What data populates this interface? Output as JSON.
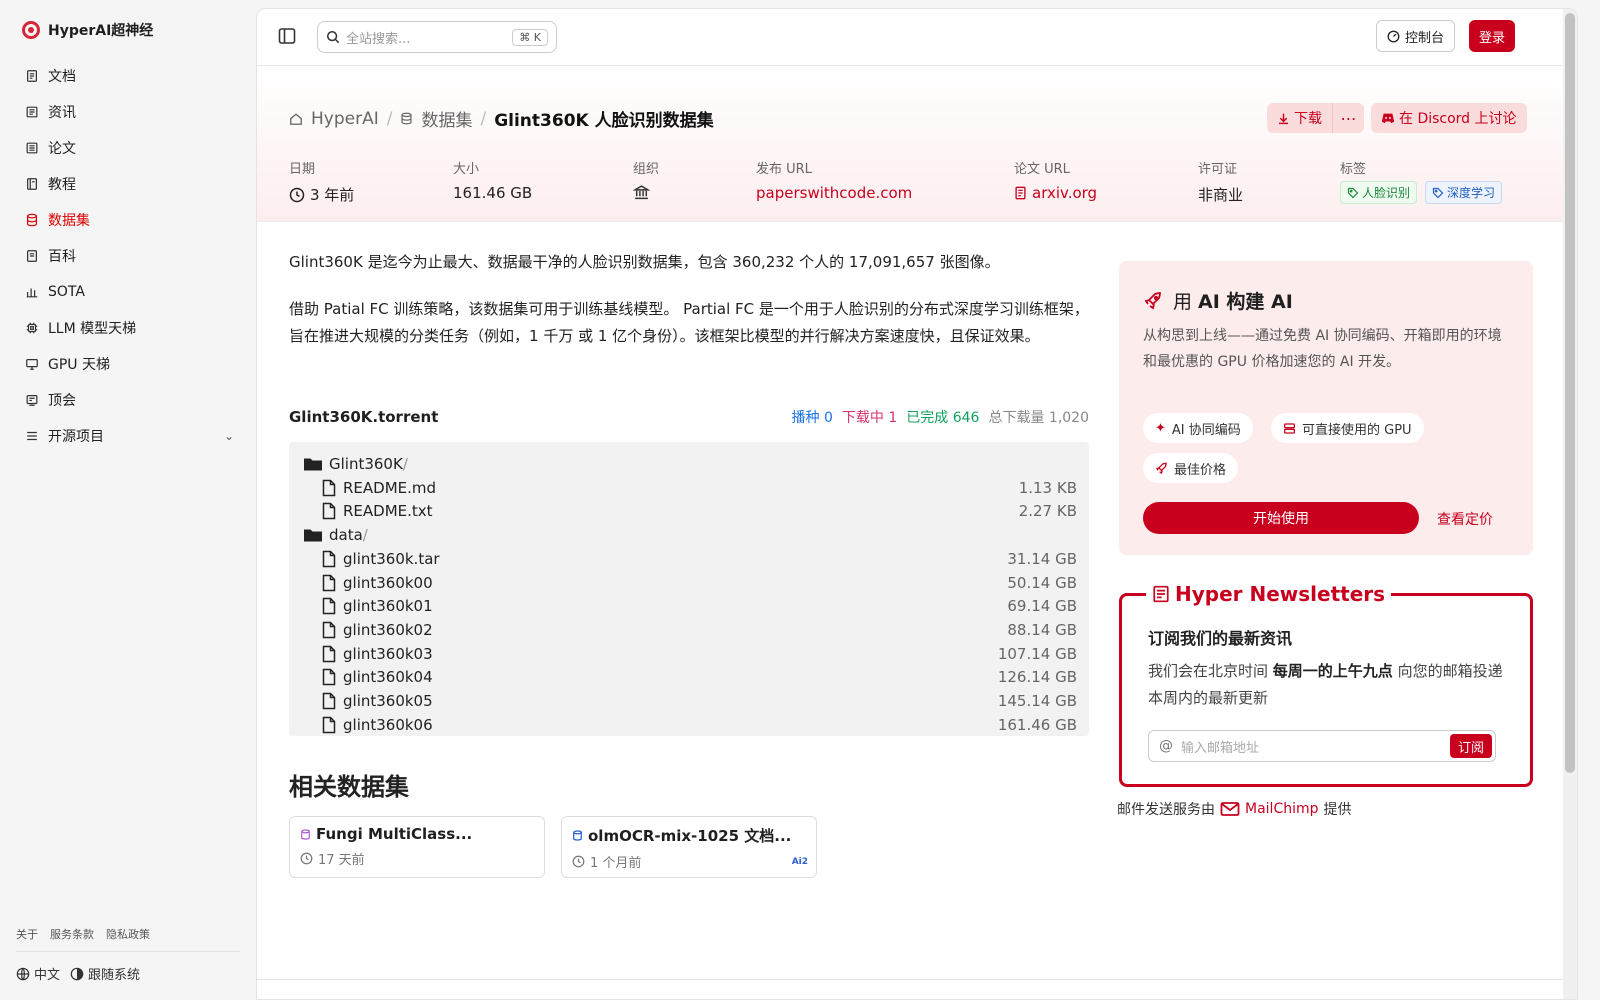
{
  "brand": {
    "name": "HyperAI超神经"
  },
  "nav": [
    {
      "label": "文档",
      "icon": "doc-icon"
    },
    {
      "label": "资讯",
      "icon": "news-icon"
    },
    {
      "label": "论文",
      "icon": "paper-icon"
    },
    {
      "label": "教程",
      "icon": "tutorial-icon"
    },
    {
      "label": "数据集",
      "icon": "database-icon"
    },
    {
      "label": "百科",
      "icon": "wiki-icon"
    },
    {
      "label": "SOTA",
      "icon": "bar-chart-icon"
    },
    {
      "label": "LLM 模型天梯",
      "icon": "cpu-icon"
    },
    {
      "label": "GPU 天梯",
      "icon": "monitor-icon"
    },
    {
      "label": "顶会",
      "icon": "conference-icon"
    },
    {
      "label": "开源项目",
      "icon": "list-icon"
    }
  ],
  "nav_active": "数据集",
  "footer": {
    "about": "关于",
    "terms": "服务条款",
    "privacy": "隐私政策",
    "language": "中文",
    "theme": "跟随系统"
  },
  "topbar": {
    "search_placeholder": "全站搜索...",
    "kbd": "K",
    "console": "控制台",
    "login": "登录"
  },
  "breadcrumb": {
    "home": "HyperAI",
    "section": "数据集",
    "current": "Glint360K 人脸识别数据集"
  },
  "actions": {
    "download": "下载",
    "discord": "在 Discord 上讨论"
  },
  "meta": {
    "date_label": "日期",
    "date_value": "3 年前",
    "size_label": "大小",
    "size_value": "161.46 GB",
    "org_label": "组织",
    "pub_label": "发布 URL",
    "pub_value": "paperswithcode.com",
    "paper_label": "论文 URL",
    "paper_value": "arxiv.org",
    "license_label": "许可证",
    "license_value": "非商业",
    "tags_label": "标签",
    "tag1": "人脸识别",
    "tag2": "深度学习"
  },
  "description": {
    "p1": "Glint360K 是迄今为止最大、数据最干净的人脸识别数据集，包含 360,232 个人的 17,091,657 张图像。",
    "p2": "借助 Patial FC 训练策略，该数据集可用于训练基线模型。 Partial FC 是一个用于人脸识别的分布式深度学习训练框架，旨在推进大规模的分类任务（例如，1 千万 或 1 亿个身份）。该框架比模型的并行解决方案速度快，且保证效果。"
  },
  "torrent": {
    "name": "Glint360K.torrent",
    "seed_label": "播种",
    "seed": "0",
    "downloading_label": "下载中",
    "downloading": "1",
    "completed_label": "已完成",
    "completed": "646",
    "total_label": "总下载量",
    "total": "1,020"
  },
  "files": [
    {
      "name": "Glint360K/",
      "type": "folder",
      "indent": 0,
      "size": ""
    },
    {
      "name": "README.md",
      "type": "file",
      "indent": 1,
      "size": "1.13 KB"
    },
    {
      "name": "README.txt",
      "type": "file",
      "indent": 1,
      "size": "2.27 KB"
    },
    {
      "name": "data/",
      "type": "folder",
      "indent": 0,
      "size": ""
    },
    {
      "name": "glint360k.tar",
      "type": "file",
      "indent": 1,
      "size": "31.14 GB"
    },
    {
      "name": "glint360k00",
      "type": "file",
      "indent": 1,
      "size": "50.14 GB"
    },
    {
      "name": "glint360k01",
      "type": "file",
      "indent": 1,
      "size": "69.14 GB"
    },
    {
      "name": "glint360k02",
      "type": "file",
      "indent": 1,
      "size": "88.14 GB"
    },
    {
      "name": "glint360k03",
      "type": "file",
      "indent": 1,
      "size": "107.14 GB"
    },
    {
      "name": "glint360k04",
      "type": "file",
      "indent": 1,
      "size": "126.14 GB"
    },
    {
      "name": "glint360k05",
      "type": "file",
      "indent": 1,
      "size": "145.14 GB"
    },
    {
      "name": "glint360k06",
      "type": "file",
      "indent": 1,
      "size": "161.46 GB"
    }
  ],
  "related": {
    "title": "相关数据集",
    "items": [
      {
        "title": "Fungi MultiClass...",
        "time": "17 天前",
        "badge": ""
      },
      {
        "title": "olmOCR-mix-1025 文档...",
        "time": "1 个月前",
        "badge": "Ai2"
      }
    ]
  },
  "promo": {
    "title_prefix": "用 ",
    "title_bold": "AI 构建 AI",
    "desc": "从构思到上线——通过免费 AI 协同编码、开箱即用的环境和最优惠的 GPU 价格加速您的 AI 开发。",
    "chip1": "AI 协同编码",
    "chip2": "可直接使用的 GPU",
    "chip3": "最佳价格",
    "start": "开始使用",
    "pricing": "查看定价"
  },
  "newsletter": {
    "legend": "Hyper Newsletters",
    "heading": "订阅我们的最新资讯",
    "p_a": "我们会在北京时间 ",
    "p_b": "每周一的上午九点",
    "p_c": " 向您的邮箱投递本周内的最新更新",
    "placeholder": "输入邮箱地址",
    "subscribe": "订阅",
    "credit_a": "邮件发送服务由",
    "credit_b": "MailChimp",
    "credit_c": "提供"
  },
  "colors": {
    "accent": "#c8001e",
    "seed": "#1a73e8",
    "downloading": "#d6336c",
    "completed": "#12a05c",
    "total": "#888888"
  }
}
